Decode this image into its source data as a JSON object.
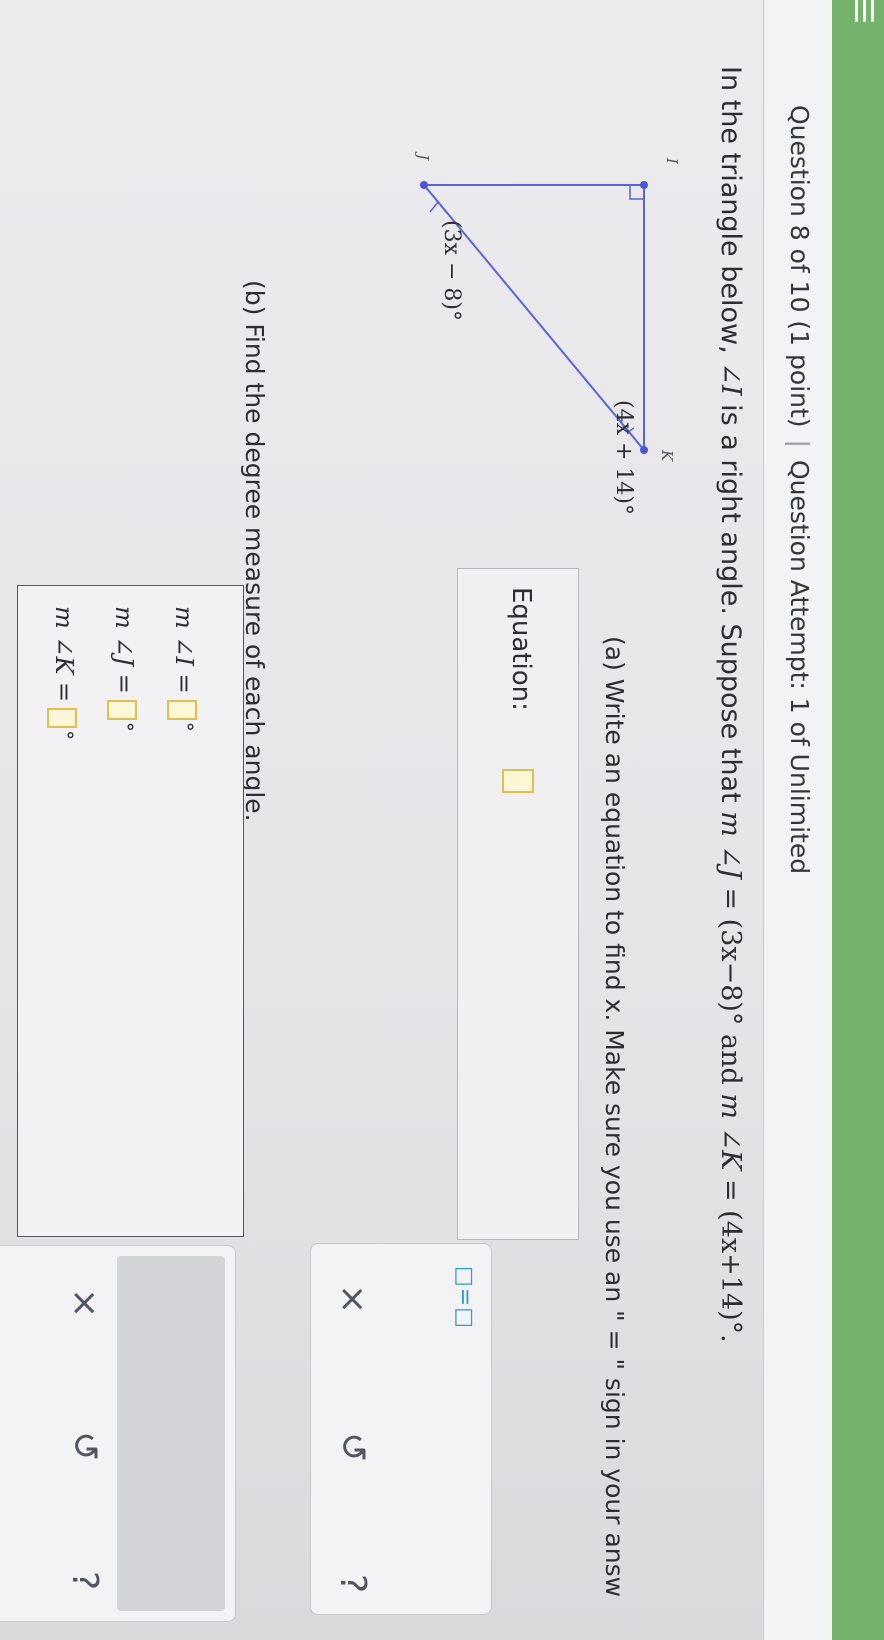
{
  "header": {
    "question": "Question 8 of 10 (1 point)",
    "separator": "|",
    "attempt": "Question Attempt: 1 of Unlimited"
  },
  "problem": {
    "intro": "In the triangle below, ",
    "angle_i": "∠I",
    "right_text": " is a right angle. Suppose that ",
    "mj": "m ∠J",
    "eq1": " = (3x−8)° and ",
    "mk": "m ∠K",
    "eq2": " = (4x+14)°."
  },
  "figure": {
    "vertex_j": "J",
    "vertex_i": "I",
    "vertex_k": "K",
    "angle_j_label": "(3x − 8)°",
    "angle_k_label": "(4x + 14)°",
    "line_color": "#5a63d8",
    "vertex_color": "#4d55d6"
  },
  "part_a": {
    "prompt": "(a) Write an equation to find x. Make sure you use an \" = \" sign in your answ",
    "equation_label": "Equation:",
    "toolbar": {
      "equals_template": "□=□",
      "clear_icon": "×",
      "undo_icon": "↺",
      "help_icon": "?"
    }
  },
  "part_b": {
    "prompt": "(b) Find the degree measure of each angle.",
    "rows": [
      {
        "label": "m ∠I =",
        "unit": "°"
      },
      {
        "label": "m ∠J =",
        "unit": "°"
      },
      {
        "label": "m ∠K =",
        "unit": "°"
      }
    ],
    "toolbar": {
      "clear_icon": "×",
      "undo_icon": "↺",
      "help_icon": "?"
    }
  },
  "colors": {
    "header_band": "#74b36c",
    "blank_border": "#e0be52",
    "blank_fill": "#fdf6d7",
    "tool_accent": "#2a9bd5"
  }
}
